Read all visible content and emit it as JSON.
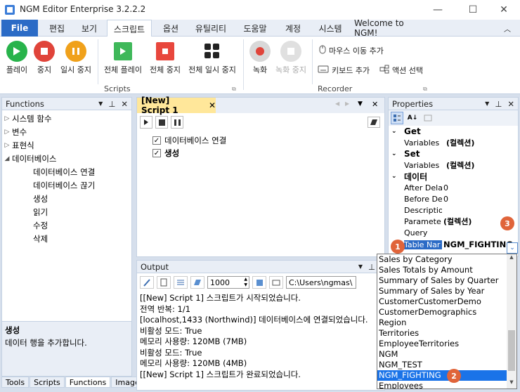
{
  "window": {
    "title": "NGM Editor Enterprise 3.2.2.2",
    "minimize": "—",
    "maximize": "☐",
    "close": "✕"
  },
  "menu": {
    "file": "File",
    "tabs": [
      "편집",
      "보기",
      "스크립트",
      "옵션",
      "유틸리티",
      "도움말",
      "계정",
      "시스템"
    ],
    "welcome": "Welcome to NGM!"
  },
  "ribbon": {
    "scripts_buttons": [
      "플레이",
      "중지",
      "일시 중지",
      "전체 플레이",
      "전체 중지",
      "전체 일시 중지"
    ],
    "scripts_group": "Scripts",
    "record": "녹화",
    "record_stop": "녹화 중지",
    "mouse_move": "마우스 이동 추가",
    "keyboard": "키보드 추가",
    "action_select": "액션 선택",
    "recorder_group": "Recorder"
  },
  "functions": {
    "header": "Functions",
    "tree": [
      {
        "label": "시스템 함수",
        "level": 0,
        "state": "collapsed"
      },
      {
        "label": "변수",
        "level": 0,
        "state": "collapsed"
      },
      {
        "label": "표현식",
        "level": 0,
        "state": "collapsed"
      },
      {
        "label": "데이터베이스",
        "level": 0,
        "state": "expanded"
      },
      {
        "label": "데이터베이스 연결",
        "level": 1
      },
      {
        "label": "데이터베이스 끊기",
        "level": 1
      },
      {
        "label": "생성",
        "level": 1
      },
      {
        "label": "읽기",
        "level": 1
      },
      {
        "label": "수정",
        "level": 1
      },
      {
        "label": "삭제",
        "level": 1
      }
    ],
    "desc_title": "생성",
    "desc_text": "데이터 행을 추가합니다."
  },
  "bottom_tabs": [
    "Tools",
    "Scripts",
    "Functions",
    "Images"
  ],
  "editor": {
    "tab": "[New] Script 1",
    "items": [
      "데이터베이스 연결",
      "생성"
    ]
  },
  "output": {
    "header": "Output",
    "count": "1000",
    "path": "C:\\Users\\ngmas\\",
    "lines": [
      "[[New] Script 1] 스크립트가 시작되었습니다.",
      "전역 반복: 1/1",
      "[localhost,1433 (Northwind)] 데이터베이스에 연결되었습니다.",
      "비활성 모드: True",
      "메모리 사용량: 120MB (7MB)",
      "비활성 모드: True",
      "메모리 사용량: 120MB (4MB)",
      "[[New] Script 1] 스크립트가 완료되었습니다."
    ]
  },
  "properties": {
    "header": "Properties",
    "sections": {
      "get": "Get",
      "set": "Set",
      "data": "데이터"
    },
    "rows": {
      "get_vars": [
        "Variables",
        "(컬렉션)"
      ],
      "set_vars": [
        "Variables",
        "(컬렉션)"
      ],
      "after": [
        "After Dela",
        "0"
      ],
      "before": [
        "Before De",
        "0"
      ],
      "desc": [
        "Descriptio",
        ""
      ],
      "params": [
        "Paramete",
        "(컬렉션)"
      ],
      "query": [
        "Query",
        ""
      ],
      "table": [
        "Table Nar",
        "NGM_FIGHTING"
      ]
    }
  },
  "dropdown": {
    "items": [
      "Sales by Category",
      "Sales Totals by Amount",
      "Summary of Sales by Quarter",
      "Summary of Sales by Year",
      "CustomerCustomerDemo",
      "CustomerDemographics",
      "Region",
      "Territories",
      "EmployeeTerritories",
      "NGM",
      "NGM_TEST",
      "NGM_FIGHTING",
      "Employees"
    ],
    "selected": "NGM_FIGHTING"
  },
  "badges": [
    "1",
    "2",
    "3"
  ],
  "colors": {
    "accent": "#2b6bc6",
    "badge": "#e0643a",
    "play": "#28b34b",
    "stop": "#e0443a",
    "pause": "#f0a11b"
  }
}
